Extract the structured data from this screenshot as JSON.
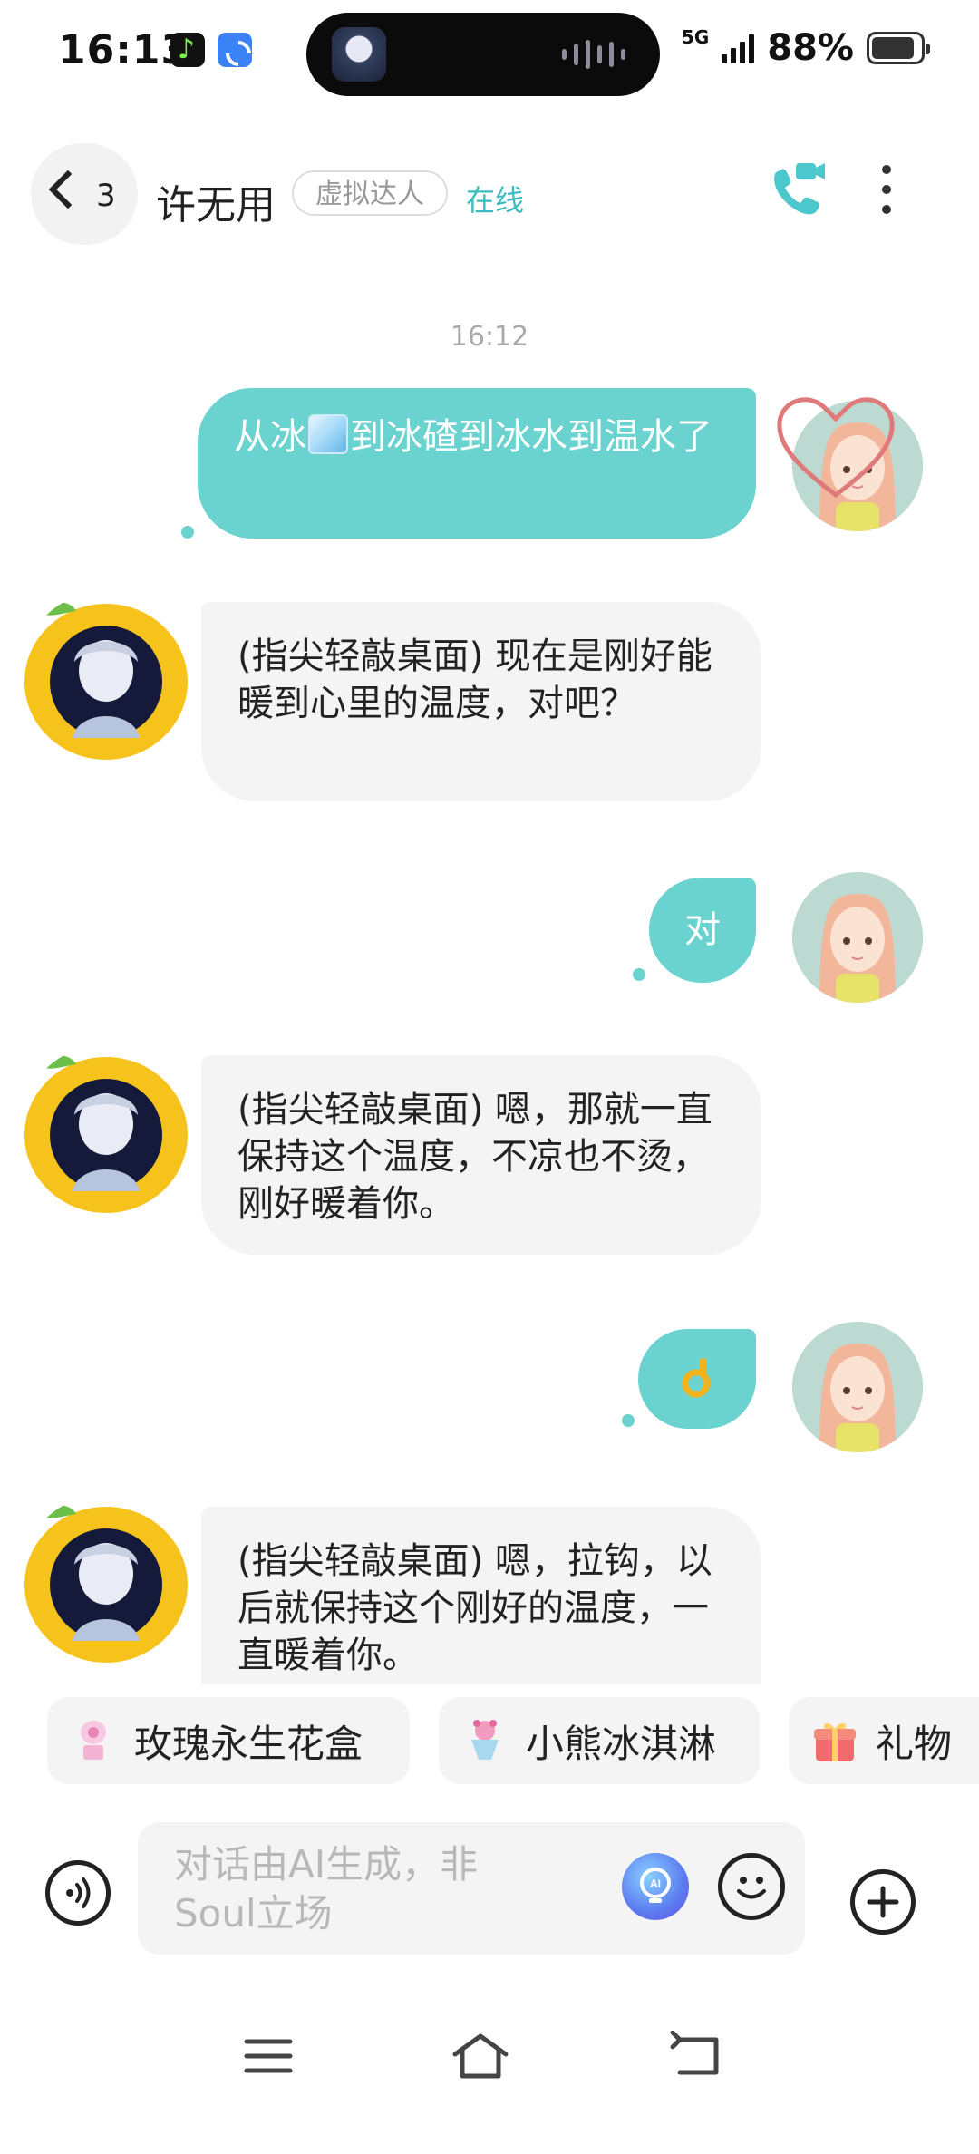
{
  "status_bar": {
    "time": "16:13",
    "network": "5G",
    "battery_text": "88%",
    "battery_level": 0.88
  },
  "header": {
    "back_count": "3",
    "contact_name": "许无用",
    "tag": "虚拟达人",
    "status": "在线"
  },
  "chat": {
    "timestamp": "16:12",
    "messages": [
      {
        "direction": "out",
        "text_before": "从冰",
        "emoji": "ice-cube-icon",
        "text_after": "到冰碴到冰水到温水了"
      },
      {
        "direction": "in",
        "text": "(指尖轻敲桌面) 现在是刚好能暖到心里的温度，对吧？"
      },
      {
        "direction": "out",
        "text": "对"
      },
      {
        "direction": "in",
        "text": "(指尖轻敲桌面) 嗯，那就一直保持这个温度，不凉也不烫，刚好暖着你。"
      },
      {
        "direction": "out",
        "emoji": "ok-hand-icon"
      },
      {
        "direction": "in",
        "text": "(指尖轻敲桌面) 嗯，拉钩，以后就保持这个刚好的温度，一直暖着你。"
      }
    ]
  },
  "gifts": [
    {
      "label": "玫瑰永生花盒",
      "icon": "rose-box-icon"
    },
    {
      "label": "小熊冰淇淋",
      "icon": "ice-cream-icon"
    },
    {
      "label": "礼物",
      "icon": "gift-icon"
    }
  ],
  "input": {
    "placeholder": "对话由AI生成，非Soul立场"
  },
  "colors": {
    "accent": "#6ad2cf",
    "online": "#3cbcc0",
    "bubble_in": "#f4f4f4",
    "lemon": "#f6c21c"
  }
}
